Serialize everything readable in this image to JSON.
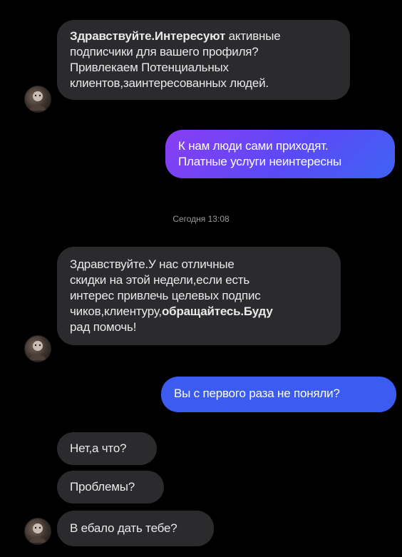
{
  "messages": {
    "m1": {
      "bold": "Здравствуйте.Интересуют",
      "rest": " активные",
      "lines": [
        "подписчики для вашего профиля?",
        "Привлекаем Потенциальных",
        "клиентов,заинтересованных людей."
      ]
    },
    "m2": {
      "lines": [
        "К нам люди сами приходят.",
        "Платные услуги неинтересны"
      ]
    },
    "timestamp": "Сегодня 13:08",
    "m3": {
      "lines": [
        "Здравствуйте.У нас отличные",
        "скидки на этой недели,если есть",
        "интерес привлечь целевых подпис"
      ],
      "line4_normal": "чиков,клиентуру,",
      "line4_bold": "обращайтесь.Буду",
      "line5": "рад помочь!"
    },
    "m4": "Вы с первого раза не поняли?",
    "m5": "Нет,а что?",
    "m6": "Проблемы?",
    "m7": "В ебало дать тебе?"
  },
  "colors": {
    "background": "#000000",
    "incoming_bubble": "#2b2b2e",
    "outgoing_gradient_start": "#8a3df2",
    "outgoing_gradient_end": "#3f63f4",
    "outgoing_blue": "#3c5bf0"
  },
  "icons": {
    "avatar": "avatar-icon"
  }
}
